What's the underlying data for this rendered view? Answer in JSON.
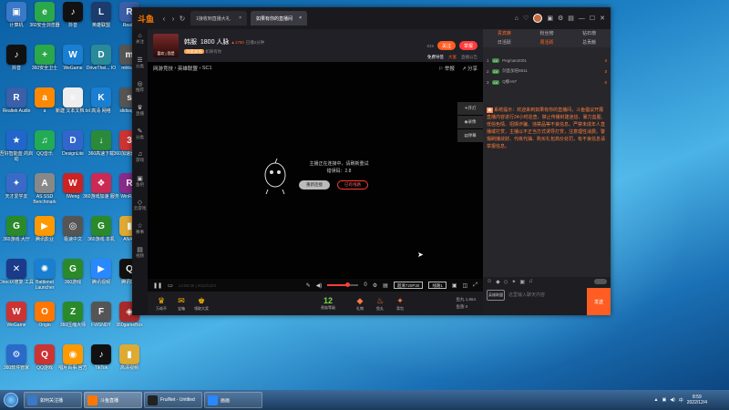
{
  "desktop": {
    "icons": [
      {
        "label": "计算机",
        "color": "#3a78c8",
        "glyph": "▣"
      },
      {
        "label": "360安全浏览器",
        "color": "#2aa84a",
        "glyph": "e"
      },
      {
        "label": "抖音",
        "color": "#111111",
        "glyph": "♪"
      },
      {
        "label": "英雄联盟",
        "color": "#1b3c6c",
        "glyph": "L"
      },
      {
        "label": "Realte",
        "color": "#3b5fa8",
        "glyph": "R"
      },
      {
        "label": "抖音",
        "color": "#111111",
        "glyph": "♪"
      },
      {
        "label": "360安全卫士",
        "color": "#2aa84a",
        "glyph": "+"
      },
      {
        "label": "WeGame",
        "color": "#1a7fd0",
        "glyph": "W"
      },
      {
        "label": "DriveThel... IO",
        "color": "#2a8a9a",
        "glyph": "D"
      },
      {
        "label": "mhloaw",
        "color": "#555555",
        "glyph": "m"
      },
      {
        "label": "Realtek Audio",
        "color": "#3b5fa8",
        "glyph": "R"
      },
      {
        "label": "a",
        "color": "#ff8800",
        "glyph": "a"
      },
      {
        "label": "新建 文本文档.txt",
        "color": "#eeeeee",
        "glyph": "≡"
      },
      {
        "label": "高清 网络",
        "color": "#1a7fd0",
        "glyph": "K"
      },
      {
        "label": "slidsap32",
        "color": "#555555",
        "glyph": "s"
      },
      {
        "label": "吾好智能蓝 的启动",
        "color": "#2266cc",
        "glyph": "★"
      },
      {
        "label": "QQ音乐",
        "color": "#22aa55",
        "glyph": "♫"
      },
      {
        "label": "DesignLite",
        "color": "#3366cc",
        "glyph": "D"
      },
      {
        "label": "360高速下载",
        "color": "#2a8a3a",
        "glyph": "↓"
      },
      {
        "label": "360加速器 大侠",
        "color": "#cc3333",
        "glyph": "3"
      },
      {
        "label": "天才爱学友",
        "color": "#3a6ac8",
        "glyph": "✦"
      },
      {
        "label": "AS SSD Benchmark",
        "color": "#888888",
        "glyph": "A"
      },
      {
        "label": "IWeng",
        "color": "#cc2222",
        "glyph": "W"
      },
      {
        "label": "360游戏加速 服务",
        "color": "#cc2a55",
        "glyph": "❖"
      },
      {
        "label": "WinRAR",
        "color": "#8a2a8a",
        "glyph": "R"
      },
      {
        "label": "360游戏 大厅",
        "color": "#2a8a2a",
        "glyph": "G"
      },
      {
        "label": "腾讯影业",
        "color": "#ff9900",
        "glyph": "▶"
      },
      {
        "label": "极速中文",
        "color": "#555555",
        "glyph": "◎"
      },
      {
        "label": "360游戏 本机",
        "color": "#2a8a2a",
        "glyph": "G"
      },
      {
        "label": "ANAP",
        "color": "#ddaa33",
        "glyph": "▮"
      },
      {
        "label": "DirectX修复 工具",
        "color": "#1a3a8a",
        "glyph": "✕"
      },
      {
        "label": "Battlenet Launcher",
        "color": "#1a7fd0",
        "glyph": "✺"
      },
      {
        "label": "360游戏",
        "color": "#2a8a2a",
        "glyph": "G"
      },
      {
        "label": "腾讯视频",
        "color": "#2a88ff",
        "glyph": "▶"
      },
      {
        "label": "腾讯QQ",
        "color": "#111111",
        "glyph": "Q"
      },
      {
        "label": "WeGame",
        "color": "#cc3333",
        "glyph": "W"
      },
      {
        "label": "Origin",
        "color": "#ff7700",
        "glyph": "O"
      },
      {
        "label": "360压缩大师",
        "color": "#2a8a2a",
        "glyph": "Z"
      },
      {
        "label": "FWSNDY",
        "color": "#555555",
        "glyph": "F"
      },
      {
        "label": "360gameBox",
        "color": "#aa2a2a",
        "glyph": "◈"
      },
      {
        "label": "360软件管家",
        "color": "#2a6ac8",
        "glyph": "⚙"
      },
      {
        "label": "QQ游戏",
        "color": "#cc3333",
        "glyph": "Q"
      },
      {
        "label": "唱片百事 官方",
        "color": "#ff9900",
        "glyph": "◉"
      },
      {
        "label": "TikTok",
        "color": "#111111",
        "glyph": "♪"
      },
      {
        "label": "高清视频",
        "color": "#ddaa33",
        "glyph": "▮"
      }
    ]
  },
  "app": {
    "logo": "斗鱼",
    "tabs": [
      {
        "label": "1接收到直播大礼"
      },
      {
        "label": "如果有你的直播间"
      }
    ],
    "window_controls": [
      "⌂",
      "♡",
      "●",
      "▣",
      "⚙",
      "▤",
      "—",
      "☐",
      "✕"
    ],
    "left_nav": [
      {
        "icon": "⌂",
        "label": "关注"
      },
      {
        "icon": "☰",
        "label": "分类"
      },
      {
        "icon": "◎",
        "label": "推荐"
      },
      {
        "icon": "♛",
        "label": "直播"
      },
      {
        "icon": "✎",
        "label": "分类"
      },
      {
        "icon": "♫",
        "label": "游戏"
      },
      {
        "icon": "▣",
        "label": "鱼吧"
      },
      {
        "icon": "◇",
        "label": "云游戏"
      },
      {
        "icon": "☆",
        "label": "赛事"
      },
      {
        "icon": "▤",
        "label": "视频"
      }
    ],
    "streamer": {
      "name": "韩服",
      "fans": "1800 人脉",
      "heat": "▲1750",
      "status": "已播2分钟",
      "tag": "剑圣加倍",
      "sub": "如果有你",
      "follow_label": "关注",
      "report_label": "举报",
      "extra": "免费导签",
      "extra2": "大富",
      "extra3": "直播公告",
      "viewers": "849",
      "avatar_caption": "喜欢 | 我是"
    },
    "player": {
      "breadcrumb": [
        "网游竞技",
        "英雄联盟",
        "SC1"
      ],
      "report": "举报",
      "share": "分享",
      "side_tools": [
        "开灯",
        "录像",
        "弹幕"
      ],
      "offline_line1": "主播正在连接中，请刷新重试",
      "offline_line2": "错误码：2.8",
      "retry_label": "重新连接",
      "feedback_label": "已有线路",
      "timestamp": "14:59:35 | 2022/12/4",
      "volume": "0",
      "quality": "超清720P30",
      "line": "线路1"
    },
    "gifts": [
      {
        "icon": "♛",
        "label": "万劫不"
      },
      {
        "icon": "✉",
        "label": "宝箱"
      },
      {
        "icon": "♚",
        "label": "领取大奖"
      }
    ],
    "level": {
      "value": "12",
      "label": "贵族等级"
    },
    "gift_actions": [
      {
        "icon": "◆",
        "label": "礼物"
      },
      {
        "icon": "♨",
        "label": "鱼丸"
      },
      {
        "icon": "✦",
        "label": "背包"
      }
    ],
    "balance": {
      "fish": "1,864",
      "coin": "0",
      "fish_label": "鱼丸",
      "coin_label": "鱼翅"
    },
    "right_panel": {
      "tabs_top": [
        "贵宾席",
        "粉丝榜",
        "钻石榜"
      ],
      "tabs_sub": [
        "日活跃",
        "周活跃",
        "总贡献"
      ],
      "ranks": [
        {
          "n": "1",
          "lvl": "LV",
          "name": "Pegman2001",
          "v": "4"
        },
        {
          "n": "2",
          "lvl": "LV",
          "name": "剑圣加倍8611",
          "v": "3"
        },
        {
          "n": "3",
          "lvl": "LV",
          "name": "Q娜A97",
          "v": "0"
        }
      ],
      "notice": "系统提示：欢迎来到如果有你的直播间，斗鱼倡议开展直播内容进行24小时巡查，禁止传播封建迷信、暴力血腥、低俗色情、招嫖诈骗、违禁品等不良信息。严禁未成年人直播或打赏，主播以不正当方式诱导打赏，注意理性消费。警惕刷播敛财、代练代抽、购买礼包高价处罚，有不良信息请举报信息。",
      "input_placeholder": "这里输入聊天内容",
      "send_label": "发送",
      "badge": "英雄联盟"
    }
  },
  "taskbar": {
    "items": [
      {
        "label": "如何关注播",
        "color": "#3a78c8"
      },
      {
        "label": "斗鱼直播",
        "color": "#ff7700"
      },
      {
        "label": "FruiNet - Untitled",
        "color": "#222222"
      },
      {
        "label": "画画",
        "color": "#2a88ff"
      }
    ],
    "time": "8:59",
    "date": "2022/12/4"
  }
}
